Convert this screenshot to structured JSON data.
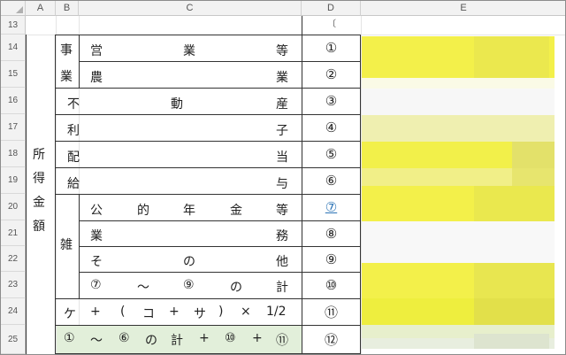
{
  "headers": {
    "a": "A",
    "b": "B",
    "c": "C",
    "d": "D",
    "e": "E"
  },
  "rows": [
    "13",
    "14",
    "15",
    "16",
    "17",
    "18",
    "19",
    "20",
    "21",
    "22",
    "23",
    "24",
    "25"
  ],
  "section_label": [
    "所",
    "得",
    "金",
    "額"
  ],
  "jigyo_label": [
    "事",
    "業"
  ],
  "zatsu_label": "雑",
  "items": {
    "eigyo": [
      "営",
      "業",
      "等"
    ],
    "nogyo": [
      "農",
      "業"
    ],
    "fudosan": [
      "不",
      "動",
      "産"
    ],
    "rishi": [
      "利",
      "子"
    ],
    "haito": [
      "配",
      "当"
    ],
    "kyuyo": [
      "給",
      "与"
    ],
    "kotekinenkin": [
      "公",
      "的",
      "年",
      "金",
      "等"
    ],
    "gyomu": [
      "業",
      "務"
    ],
    "sonota": [
      "そ",
      "の",
      "他"
    ],
    "kei": [
      "⑦",
      "〜",
      "⑨",
      "の",
      "計"
    ],
    "formula_ke": [
      "ケ",
      "+",
      "(",
      "コ",
      "+",
      "サ",
      ")",
      "×",
      "1/2"
    ],
    "formula_total": [
      "①",
      "〜",
      "⑥",
      "の",
      "計",
      "+",
      "⑩",
      "+",
      "⑪"
    ]
  },
  "codes": [
    "①",
    "②",
    "③",
    "④",
    "⑤",
    "⑥",
    "⑦",
    "⑧",
    "⑨",
    "⑩",
    "⑪",
    "⑫"
  ],
  "colors": {
    "highlight": "#f2f040",
    "green": "#e2efda",
    "link": "#2e75b6"
  }
}
